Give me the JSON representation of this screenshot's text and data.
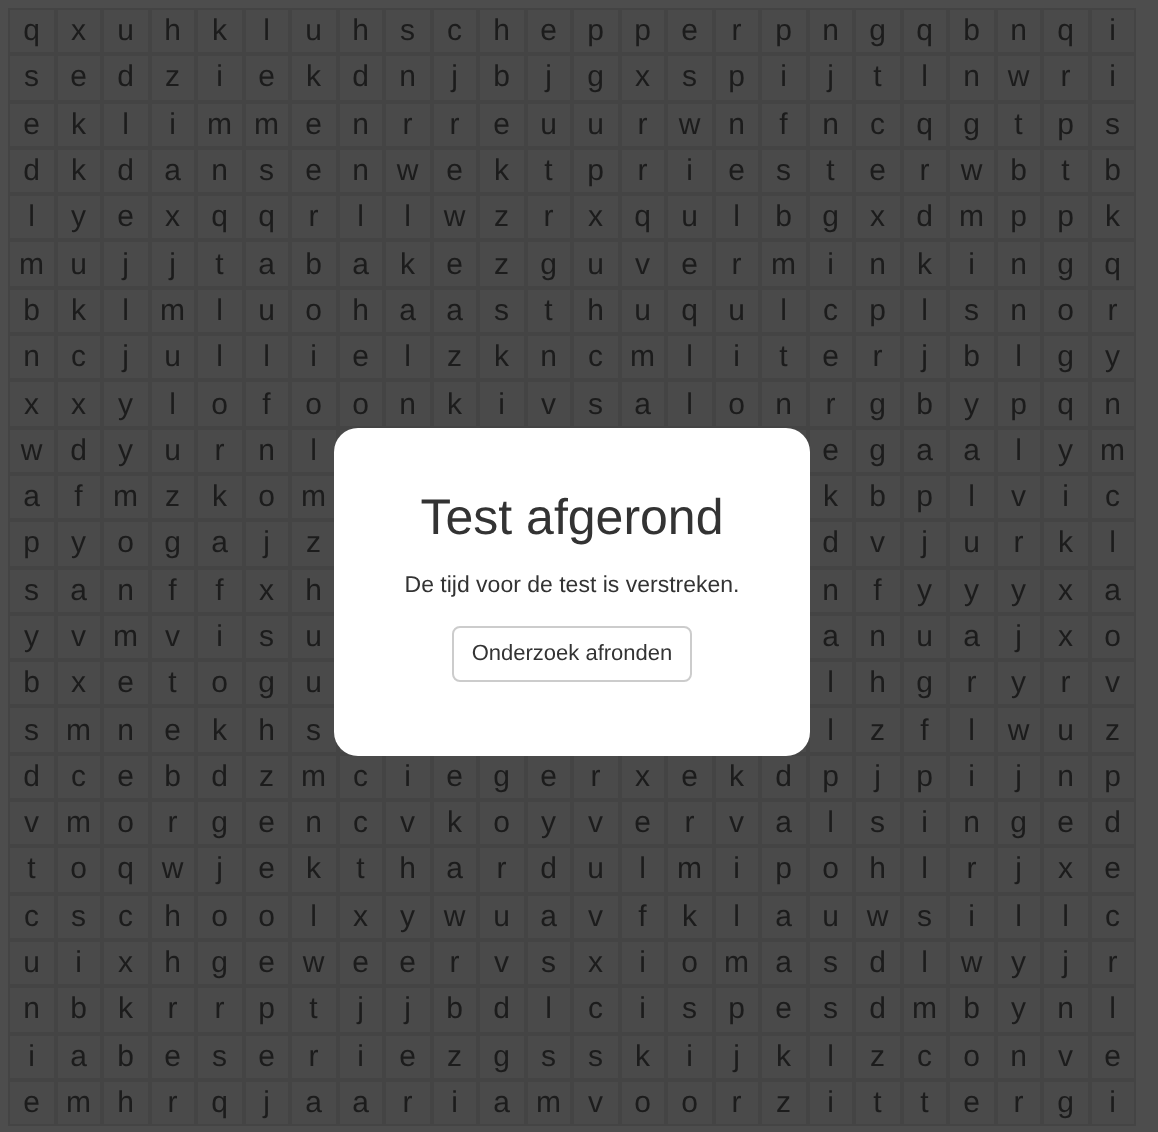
{
  "grid": {
    "rows": [
      {
        "cells": [
          "q",
          "x",
          "u",
          "h",
          "k",
          "l",
          "u",
          "h",
          "s",
          "c",
          "h",
          "e",
          "p",
          "p",
          "e",
          "r",
          "p",
          "n",
          "g",
          "q",
          "b",
          "n",
          "q",
          "i"
        ]
      },
      {
        "cells": [
          "s",
          "e",
          "d",
          "z",
          "i",
          "e",
          "k",
          "d",
          "n",
          "j",
          "b",
          "j",
          "g",
          "x",
          "s",
          "p",
          "i",
          "j",
          "t",
          "l",
          "n",
          "w",
          "r",
          "i"
        ]
      },
      {
        "cells": [
          "e",
          "k",
          "l",
          "i",
          "m",
          "m",
          "e",
          "n",
          "r",
          "r",
          "e",
          "u",
          "u",
          "r",
          "w",
          "n",
          "f",
          "n",
          "c",
          "q",
          "g",
          "t",
          "p",
          "s"
        ]
      },
      {
        "cells": [
          "d",
          "k",
          "d",
          "a",
          "n",
          "s",
          "e",
          "n",
          "w",
          "e",
          "k",
          "t",
          "p",
          "r",
          "i",
          "e",
          "s",
          "t",
          "e",
          "r",
          "w",
          "b",
          "t",
          "b"
        ]
      },
      {
        "cells": [
          "l",
          "y",
          "e",
          "x",
          "q",
          "q",
          "r",
          "l",
          "l",
          "w",
          "z",
          "r",
          "x",
          "q",
          "u",
          "l",
          "b",
          "g",
          "x",
          "d",
          "m",
          "p",
          "p",
          "k"
        ]
      },
      {
        "cells": [
          "m",
          "u",
          "j",
          "j",
          "t",
          "a",
          "b",
          "a",
          "k",
          "e",
          "z",
          "g",
          "u",
          "v",
          "e",
          "r",
          "m",
          "i",
          "n",
          "k",
          "i",
          "n",
          "g",
          "q"
        ]
      },
      {
        "cells": [
          "b",
          "k",
          "l",
          "m",
          "l",
          "u",
          "o",
          "h",
          "a",
          "a",
          "s",
          "t",
          "h",
          "u",
          "q",
          "u",
          "l",
          "c",
          "p",
          "l",
          "s",
          "n",
          "o",
          "r"
        ]
      },
      {
        "cells": [
          "n",
          "c",
          "j",
          "u",
          "l",
          "l",
          "i",
          "e",
          "l",
          "z",
          "k",
          "n",
          "c",
          "m",
          "l",
          "i",
          "t",
          "e",
          "r",
          "j",
          "b",
          "l",
          "g",
          "y"
        ]
      },
      {
        "cells": [
          "x",
          "x",
          "y",
          "l",
          "o",
          "f",
          "o",
          "o",
          "n",
          "k",
          "i",
          "v",
          "s",
          "a",
          "l",
          "o",
          "n",
          "r",
          "g",
          "b",
          "y",
          "p",
          "q",
          "n"
        ]
      },
      {
        "cells_left": [
          "w",
          "d",
          "y",
          "u",
          "r",
          "n",
          "l"
        ],
        "cells_right": [
          "e",
          "g",
          "a",
          "a",
          "l",
          "y",
          "m"
        ]
      },
      {
        "cells_left": [
          "a",
          "f",
          "m",
          "z",
          "k",
          "o",
          "m"
        ],
        "cells_right": [
          "k",
          "b",
          "p",
          "l",
          "v",
          "i",
          "c"
        ]
      },
      {
        "cells_left": [
          "p",
          "y",
          "o",
          "g",
          "a",
          "j",
          "z"
        ],
        "cells_right": [
          "d",
          "v",
          "j",
          "u",
          "r",
          "k",
          "l"
        ]
      },
      {
        "cells_left": [
          "s",
          "a",
          "n",
          "f",
          "f",
          "x",
          "h"
        ],
        "cells_right": [
          "n",
          "f",
          "y",
          "y",
          "y",
          "x",
          "a"
        ]
      },
      {
        "cells_left": [
          "y",
          "v",
          "m",
          "v",
          "i",
          "s",
          "u"
        ],
        "cells_right": [
          "a",
          "n",
          "u",
          "a",
          "j",
          "x",
          "o"
        ]
      },
      {
        "cells_left": [
          "b",
          "x",
          "e",
          "t",
          "o",
          "g",
          "u"
        ],
        "cells_right": [
          "l",
          "h",
          "g",
          "r",
          "y",
          "r",
          "v"
        ]
      },
      {
        "cells_left": [
          "s",
          "m",
          "n",
          "e",
          "k",
          "h",
          "s"
        ],
        "cells_right": [
          "l",
          "z",
          "f",
          "l",
          "w",
          "u",
          "z"
        ]
      },
      {
        "cells": [
          "d",
          "c",
          "e",
          "b",
          "d",
          "z",
          "m",
          "c",
          "i",
          "e",
          "g",
          "e",
          "r",
          "x",
          "e",
          "k",
          "d",
          "p",
          "j",
          "p",
          "i",
          "j",
          "n",
          "p"
        ]
      },
      {
        "cells": [
          "v",
          "m",
          "o",
          "r",
          "g",
          "e",
          "n",
          "c",
          "v",
          "k",
          "o",
          "y",
          "v",
          "e",
          "r",
          "v",
          "a",
          "l",
          "s",
          "i",
          "n",
          "g",
          "e",
          "d"
        ]
      },
      {
        "cells": [
          "t",
          "o",
          "q",
          "w",
          "j",
          "e",
          "k",
          "t",
          "h",
          "a",
          "r",
          "d",
          "u",
          "l",
          "m",
          "i",
          "p",
          "o",
          "h",
          "l",
          "r",
          "j",
          "x",
          "e"
        ]
      },
      {
        "cells": [
          "c",
          "s",
          "c",
          "h",
          "o",
          "o",
          "l",
          "x",
          "y",
          "w",
          "u",
          "a",
          "v",
          "f",
          "k",
          "l",
          "a",
          "u",
          "w",
          "s",
          "i",
          "l",
          "l",
          "c"
        ]
      },
      {
        "cells": [
          "u",
          "i",
          "x",
          "h",
          "g",
          "e",
          "w",
          "e",
          "e",
          "r",
          "v",
          "s",
          "x",
          "i",
          "o",
          "m",
          "a",
          "s",
          "d",
          "l",
          "w",
          "y",
          "j",
          "r"
        ]
      },
      {
        "cells": [
          "n",
          "b",
          "k",
          "r",
          "r",
          "p",
          "t",
          "j",
          "j",
          "b",
          "d",
          "l",
          "c",
          "i",
          "s",
          "p",
          "e",
          "s",
          "d",
          "m",
          "b",
          "y",
          "n",
          "l"
        ]
      },
      {
        "cells": [
          "i",
          "a",
          "b",
          "e",
          "s",
          "e",
          "r",
          "i",
          "e",
          "z",
          "g",
          "s",
          "s",
          "k",
          "i",
          "j",
          "k",
          "l",
          "z",
          "c",
          "o",
          "n",
          "v",
          "e"
        ]
      },
      {
        "cells": [
          "e",
          "m",
          "h",
          "r",
          "q",
          "j",
          "a",
          "a",
          "r",
          "i",
          "a",
          "m",
          "v",
          "o",
          "o",
          "r",
          "z",
          "i",
          "t",
          "t",
          "e",
          "r",
          "g",
          "i"
        ]
      }
    ]
  },
  "dialog": {
    "title": "Test afgerond",
    "message": "De tijd voor de test is verstreken.",
    "button": "Onderzoek afronden"
  }
}
